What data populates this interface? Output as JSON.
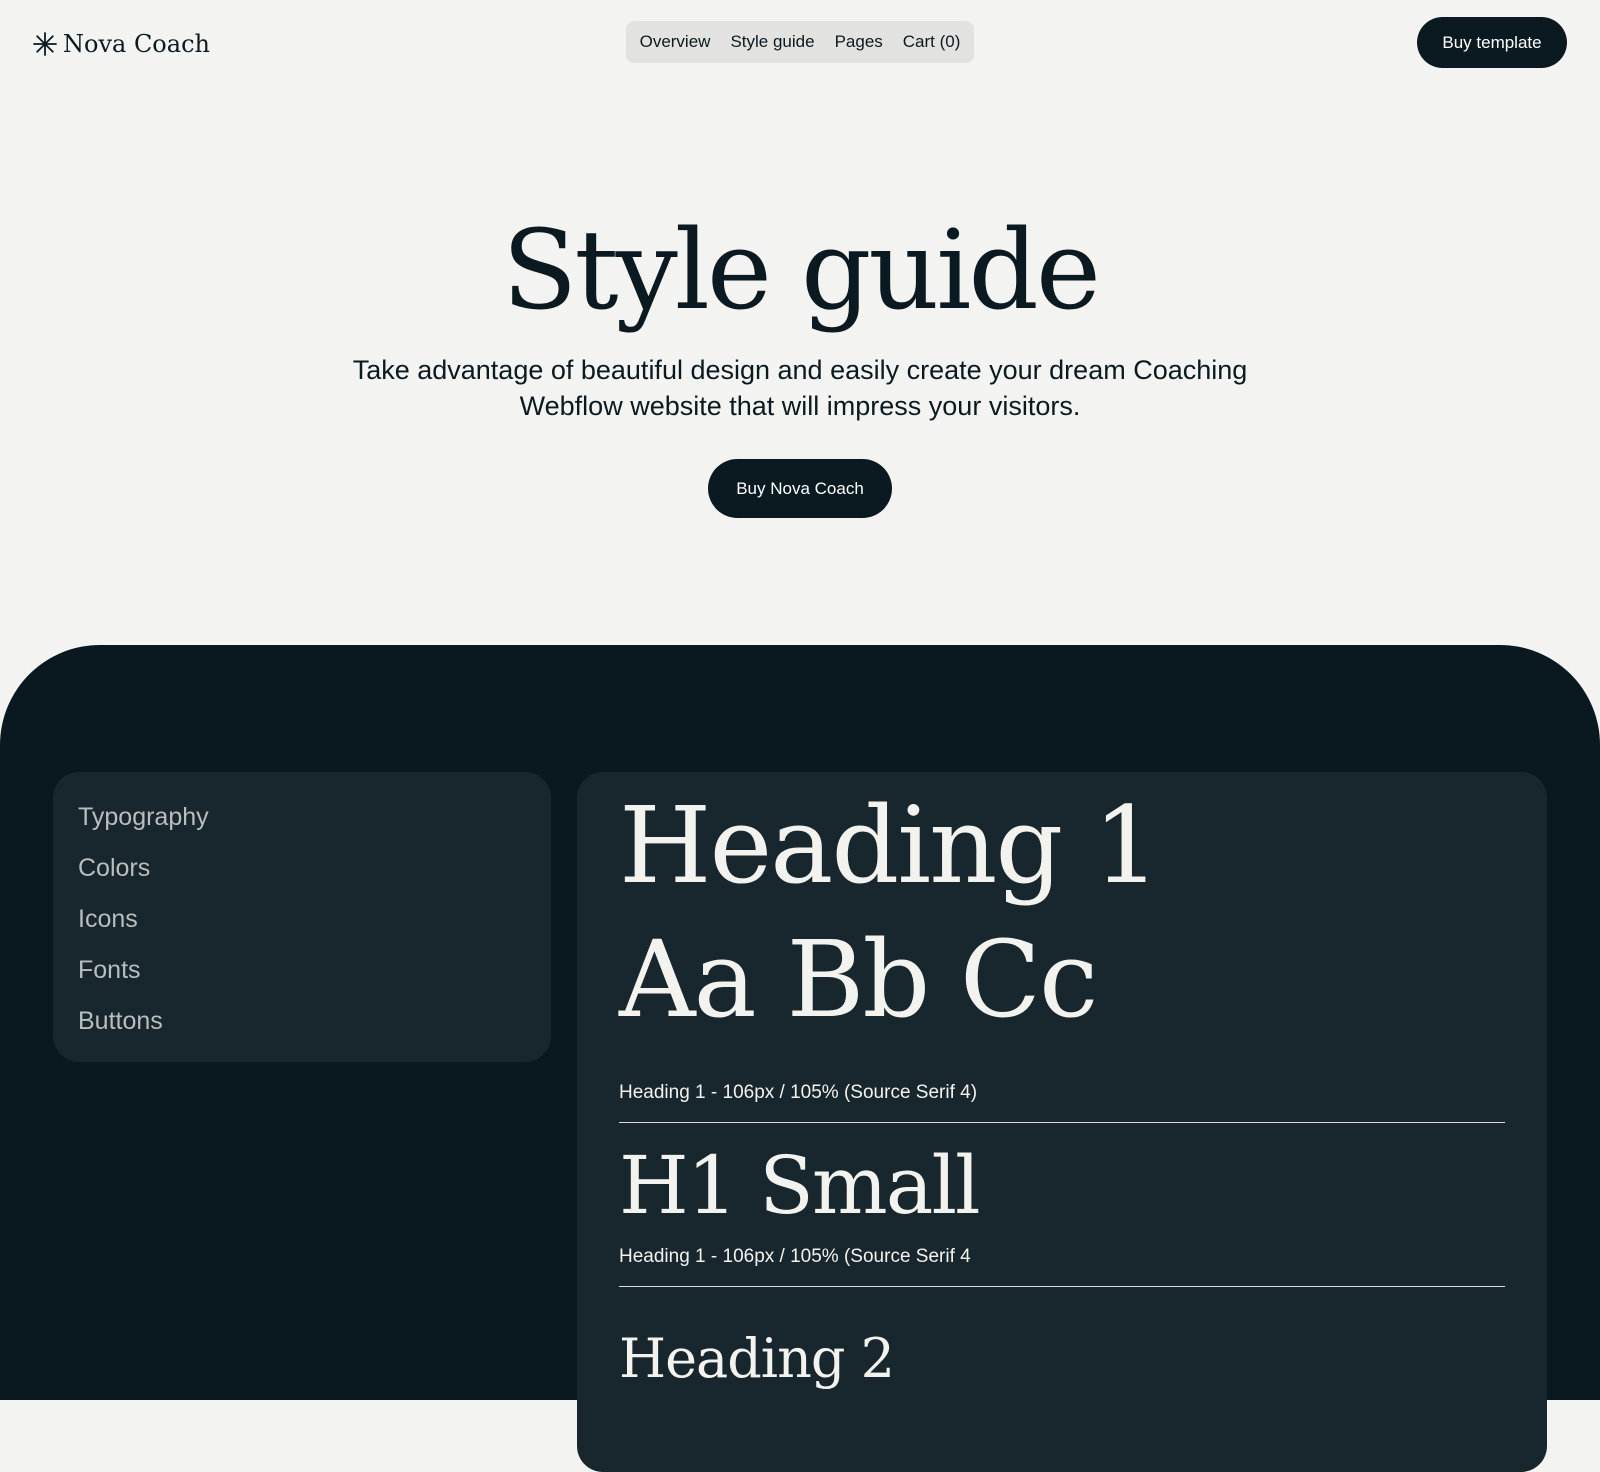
{
  "header": {
    "logo_text": "Nova Coach",
    "logo_icon": "asterisk-icon",
    "nav": [
      "Overview",
      "Style guide",
      "Pages",
      "Cart (0)"
    ],
    "cta_label": "Buy template"
  },
  "hero": {
    "title": "Style guide",
    "subtitle": "Take advantage of beautiful design and easily create your dream Coaching Webflow website that will impress your visitors.",
    "cta_label": "Buy Nova Coach"
  },
  "sidebar": {
    "items": [
      "Typography",
      "Colors",
      "Icons",
      "Fonts",
      "Buttons"
    ]
  },
  "typography": {
    "h1_sample": "Heading 1",
    "h1_letters": "Aa Bb Cc",
    "h1_caption": "Heading 1 - 106px / 105% (Source Serif 4)",
    "h1_small_sample": "H1 Small",
    "h1_small_caption": "Heading 1 - 106px / 105% (Source Serif 4",
    "h2_sample": "Heading 2"
  },
  "colors": {
    "page_background": "#f3f3f1",
    "dark": "#0b1a21",
    "dark_section": "#0a181f",
    "panel": "#18262d",
    "light_text": "#f2f2ee",
    "muted_text": "#b9bdbd",
    "nav_background": "#e2e3e0"
  }
}
